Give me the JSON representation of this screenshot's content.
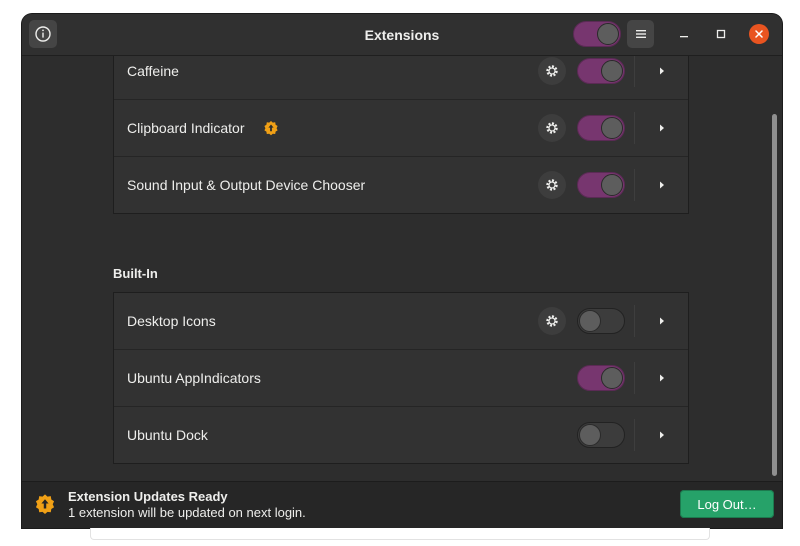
{
  "window": {
    "title": "Extensions"
  },
  "header": {
    "master_toggle_on": true
  },
  "user_section": {
    "rows": [
      {
        "label": "Caffeine",
        "has_settings": true,
        "enabled": true,
        "update_badge": false
      },
      {
        "label": "Clipboard Indicator",
        "has_settings": true,
        "enabled": true,
        "update_badge": true
      },
      {
        "label": "Sound Input & Output Device Chooser",
        "has_settings": true,
        "enabled": true,
        "update_badge": false
      }
    ]
  },
  "builtin_section": {
    "title": "Built-In",
    "rows": [
      {
        "label": "Desktop Icons",
        "has_settings": true,
        "enabled": false
      },
      {
        "label": "Ubuntu AppIndicators",
        "has_settings": false,
        "enabled": true
      },
      {
        "label": "Ubuntu Dock",
        "has_settings": false,
        "enabled": false
      }
    ]
  },
  "footer": {
    "title": "Extension Updates Ready",
    "subtitle": "1 extension will be updated on next login.",
    "button_label": "Log Out…"
  },
  "colors": {
    "accent_toggle": "#77366f",
    "update_badge": "#f0a016",
    "logout_button": "#26a269"
  }
}
